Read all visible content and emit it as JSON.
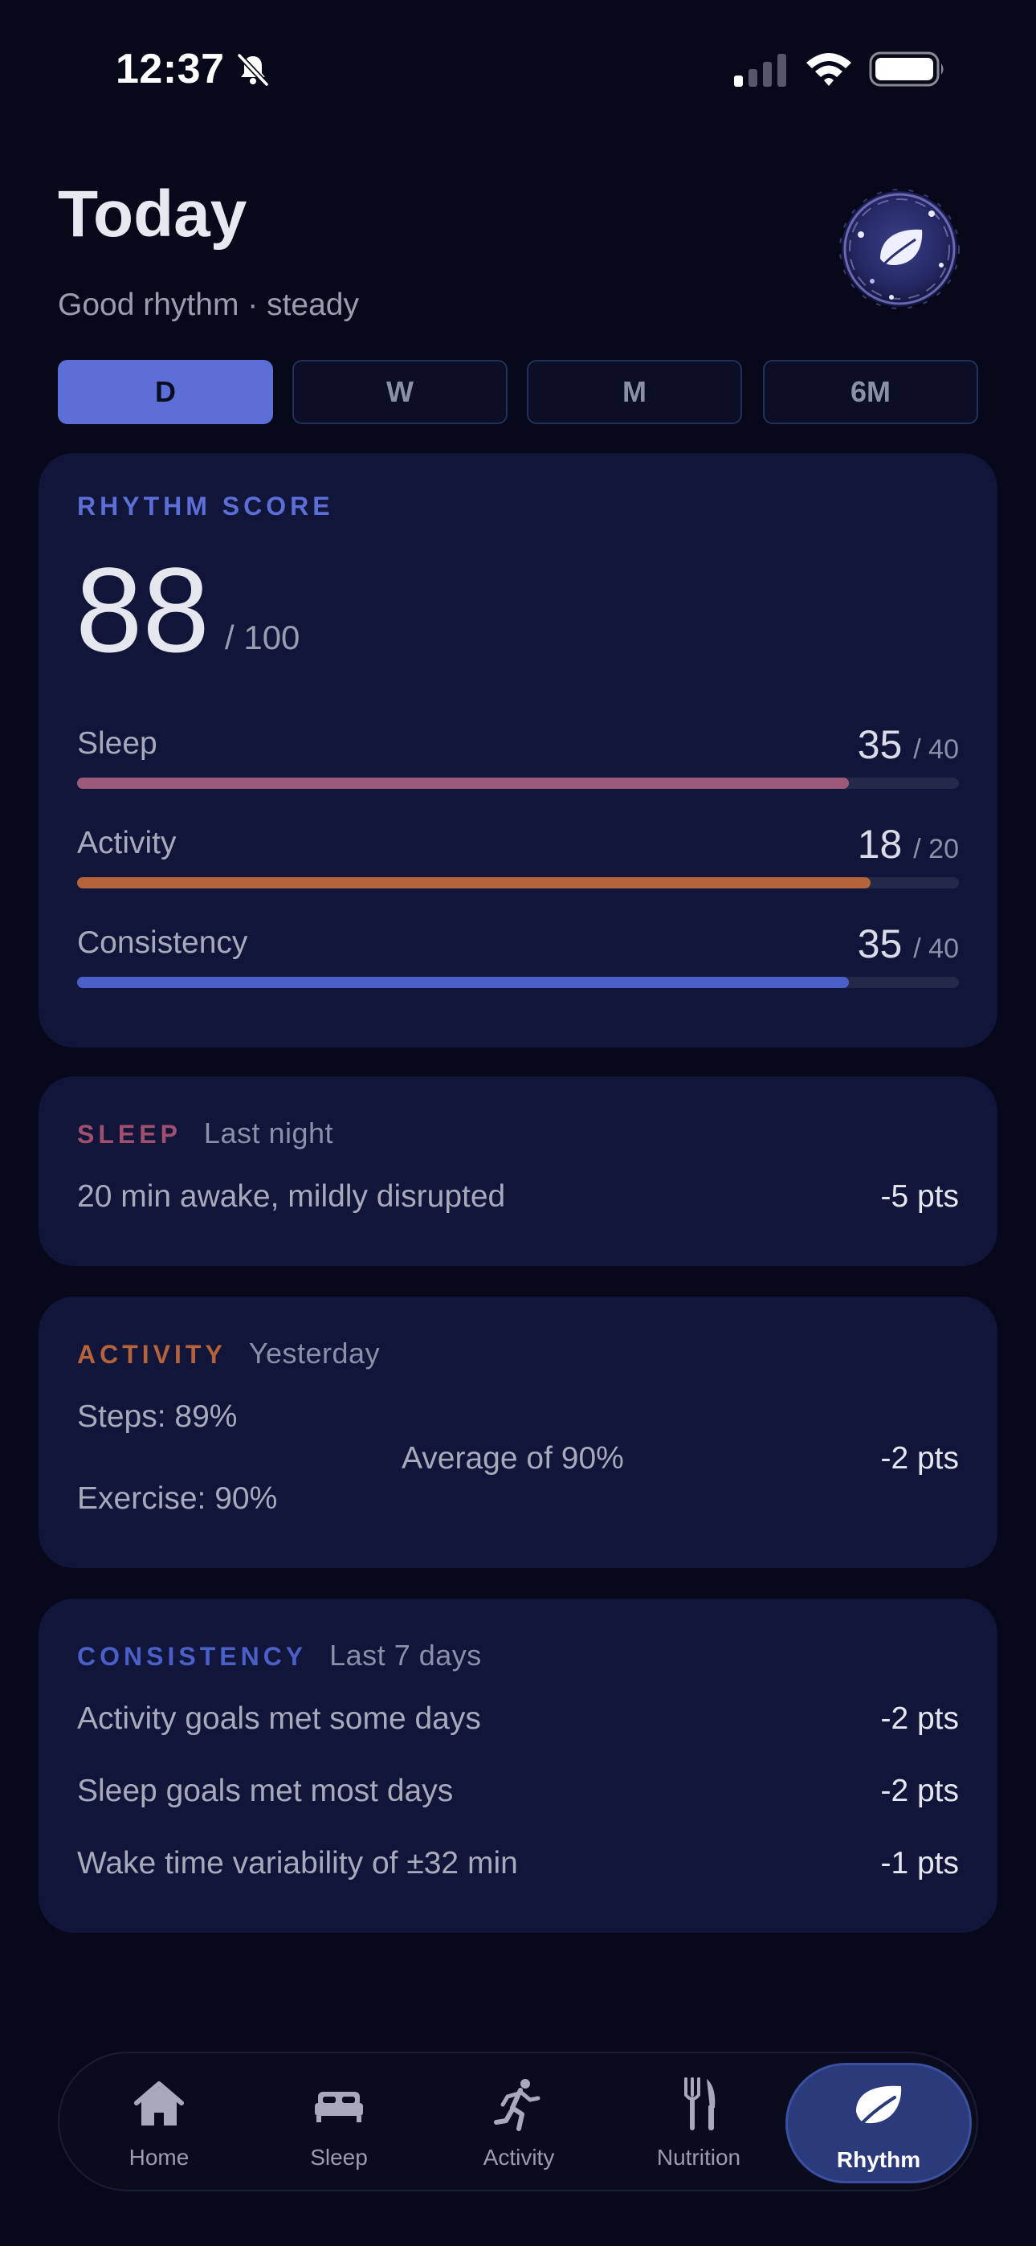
{
  "status": {
    "time": "12:37"
  },
  "header": {
    "title": "Today",
    "subtitle": "Good rhythm · steady"
  },
  "range": {
    "options": [
      "D",
      "W",
      "M",
      "6M"
    ],
    "selected": "D"
  },
  "score": {
    "label": "RHYTHM SCORE",
    "value": "88",
    "denominator": "/ 100",
    "metrics": [
      {
        "name": "Sleep",
        "value": "35",
        "max": "/ 40",
        "fraction": 0.875,
        "color": "#9b5a7a"
      },
      {
        "name": "Activity",
        "value": "18",
        "max": "/ 20",
        "fraction": 0.9,
        "color": "#b4633a"
      },
      {
        "name": "Consistency",
        "value": "35",
        "max": "/ 40",
        "fraction": 0.875,
        "color": "#4a5fc8"
      }
    ]
  },
  "sleep": {
    "label": "SLEEP",
    "label_color": "#a0506e",
    "sub": "Last night",
    "text": "20 min awake, mildly disrupted",
    "pts": "-5 pts"
  },
  "activity": {
    "label": "ACTIVITY",
    "label_color": "#b4633a",
    "sub": "Yesterday",
    "steps": "Steps: 89%",
    "exercise": "Exercise: 90%",
    "average": "Average of 90%",
    "pts": "-2 pts"
  },
  "consistency": {
    "label": "CONSISTENCY",
    "label_color": "#4a5fc8",
    "sub": "Last 7 days",
    "rows": [
      {
        "text": "Activity goals met some days",
        "pts": "-2 pts"
      },
      {
        "text": "Sleep goals met most days",
        "pts": "-2 pts"
      },
      {
        "text": "Wake time variability of ±32 min",
        "pts": "-1 pts"
      }
    ]
  },
  "tabs": [
    {
      "label": "Home",
      "icon": "home-icon"
    },
    {
      "label": "Sleep",
      "icon": "bed-icon"
    },
    {
      "label": "Activity",
      "icon": "runner-icon"
    },
    {
      "label": "Nutrition",
      "icon": "fork-knife-icon"
    },
    {
      "label": "Rhythm",
      "icon": "leaf-icon",
      "active": true
    }
  ]
}
